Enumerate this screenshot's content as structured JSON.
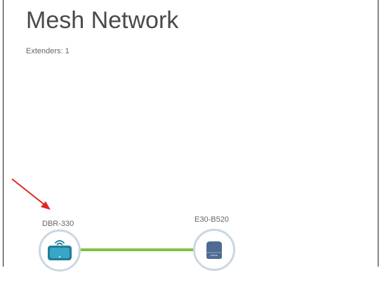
{
  "page": {
    "title": "Mesh Network",
    "extenders_label": "Extenders: 1"
  },
  "nodes": [
    {
      "label": "DBR-330",
      "icon": "router-icon"
    },
    {
      "label": "E30-B520",
      "icon": "extender-icon"
    }
  ],
  "colors": {
    "link": "#7dc142",
    "router_body": "#1f7d99",
    "extender_body": "#4f6b93",
    "node_ring": "#c9d8e2",
    "annotation_arrow": "#e0261f"
  }
}
